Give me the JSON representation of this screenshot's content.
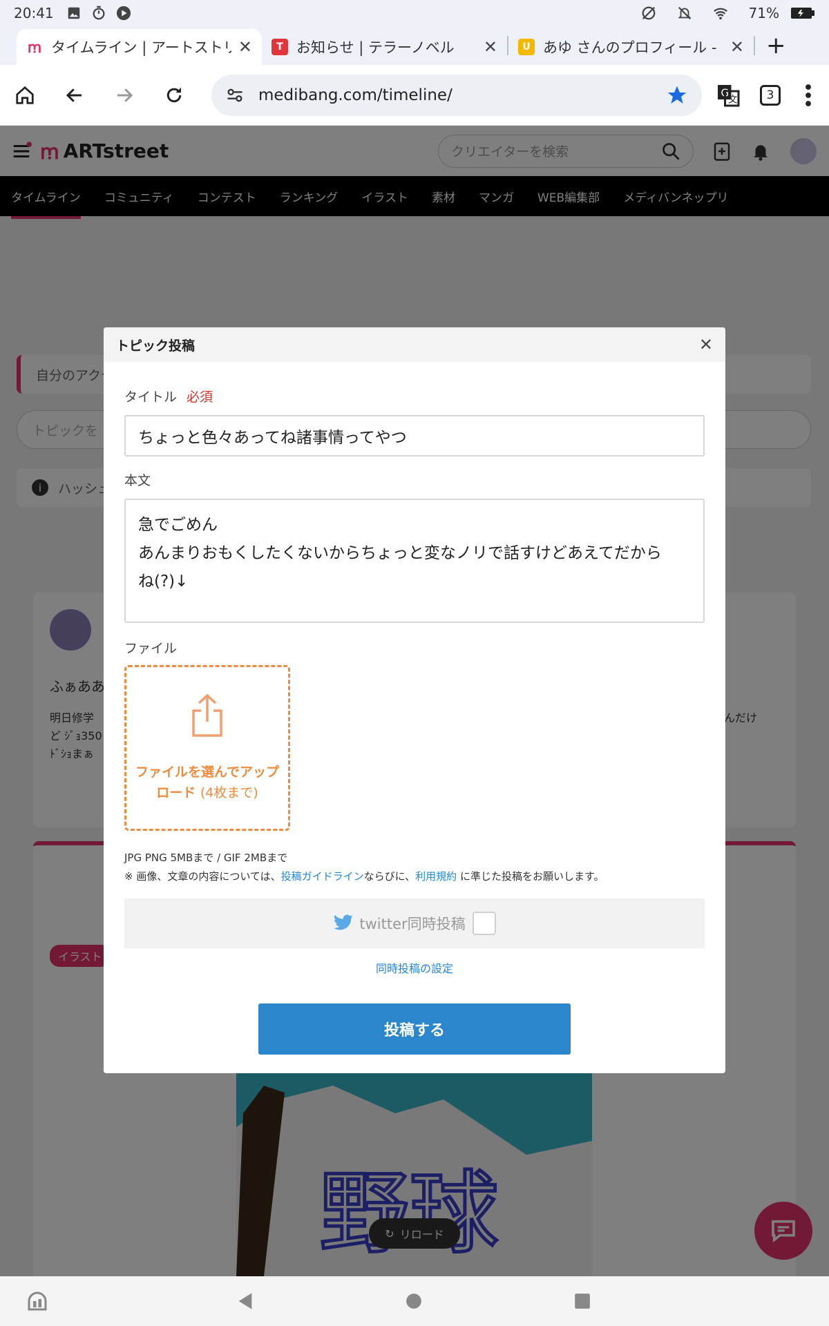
{
  "status_bar": {
    "time": "20:41",
    "battery": "71%"
  },
  "tabs": [
    {
      "title": "タイムライン | アートストリ",
      "active": true,
      "favicon_color": "#e5336b"
    },
    {
      "title": "お知らせ | テラーノベル",
      "active": false,
      "favicon_color": "#e0353c"
    },
    {
      "title": "あゆ さんのプロフィール - ",
      "active": false,
      "favicon_color": "#f5b800"
    }
  ],
  "address_bar": {
    "url": "medibang.com/timeline/",
    "tab_count": "3"
  },
  "site": {
    "logo": "ARTstreet",
    "search_placeholder": "クリエイターを検索",
    "nav": [
      "タイムライン",
      "コミュニティ",
      "コンテスト",
      "ランキング",
      "イラスト",
      "素材",
      "マンガ",
      "WEB編集部",
      "メディバンネップリ"
    ],
    "activity_label": "自分のアクテ",
    "topic_search": "トピックを",
    "hashtag_label": "ハッシュ",
    "post1": {
      "heading": "ふぁああ",
      "line1": "明日修学",
      "line2": "ど ｼﾞｮ350",
      "line3": "ﾄﾞｼｮまぁ",
      "right_text": "んだけ"
    },
    "post2_tag": "イラスト",
    "reload_label": "リロード"
  },
  "modal": {
    "title": "トピック投稿",
    "title_label": "タイトル",
    "required_label": "必須",
    "title_value": "ちょっと色々あってね諸事情ってやつ",
    "body_label": "本文",
    "body_lines": [
      "急でごめん",
      "あんまりおもくしたくないからちょっと変なノリで話すけどあえてだから",
      "ね(?)↓"
    ],
    "file_label": "ファイル",
    "upload_text": "ファイルを選んでアップロード",
    "upload_limit": "(4枚まで)",
    "file_limits": "JPG PNG 5MBまで / GIF 2MBまで",
    "notice_prefix": "※ 画像、文章の内容については、",
    "guideline_link": "投稿ガイドライン",
    "notice_middle": "ならびに、",
    "terms_link": "利用規約",
    "notice_suffix": "に準じた投稿をお願いします。",
    "twitter_label": "twitter同時投稿",
    "settings_link": "同時投稿の設定",
    "submit_label": "投稿する"
  }
}
